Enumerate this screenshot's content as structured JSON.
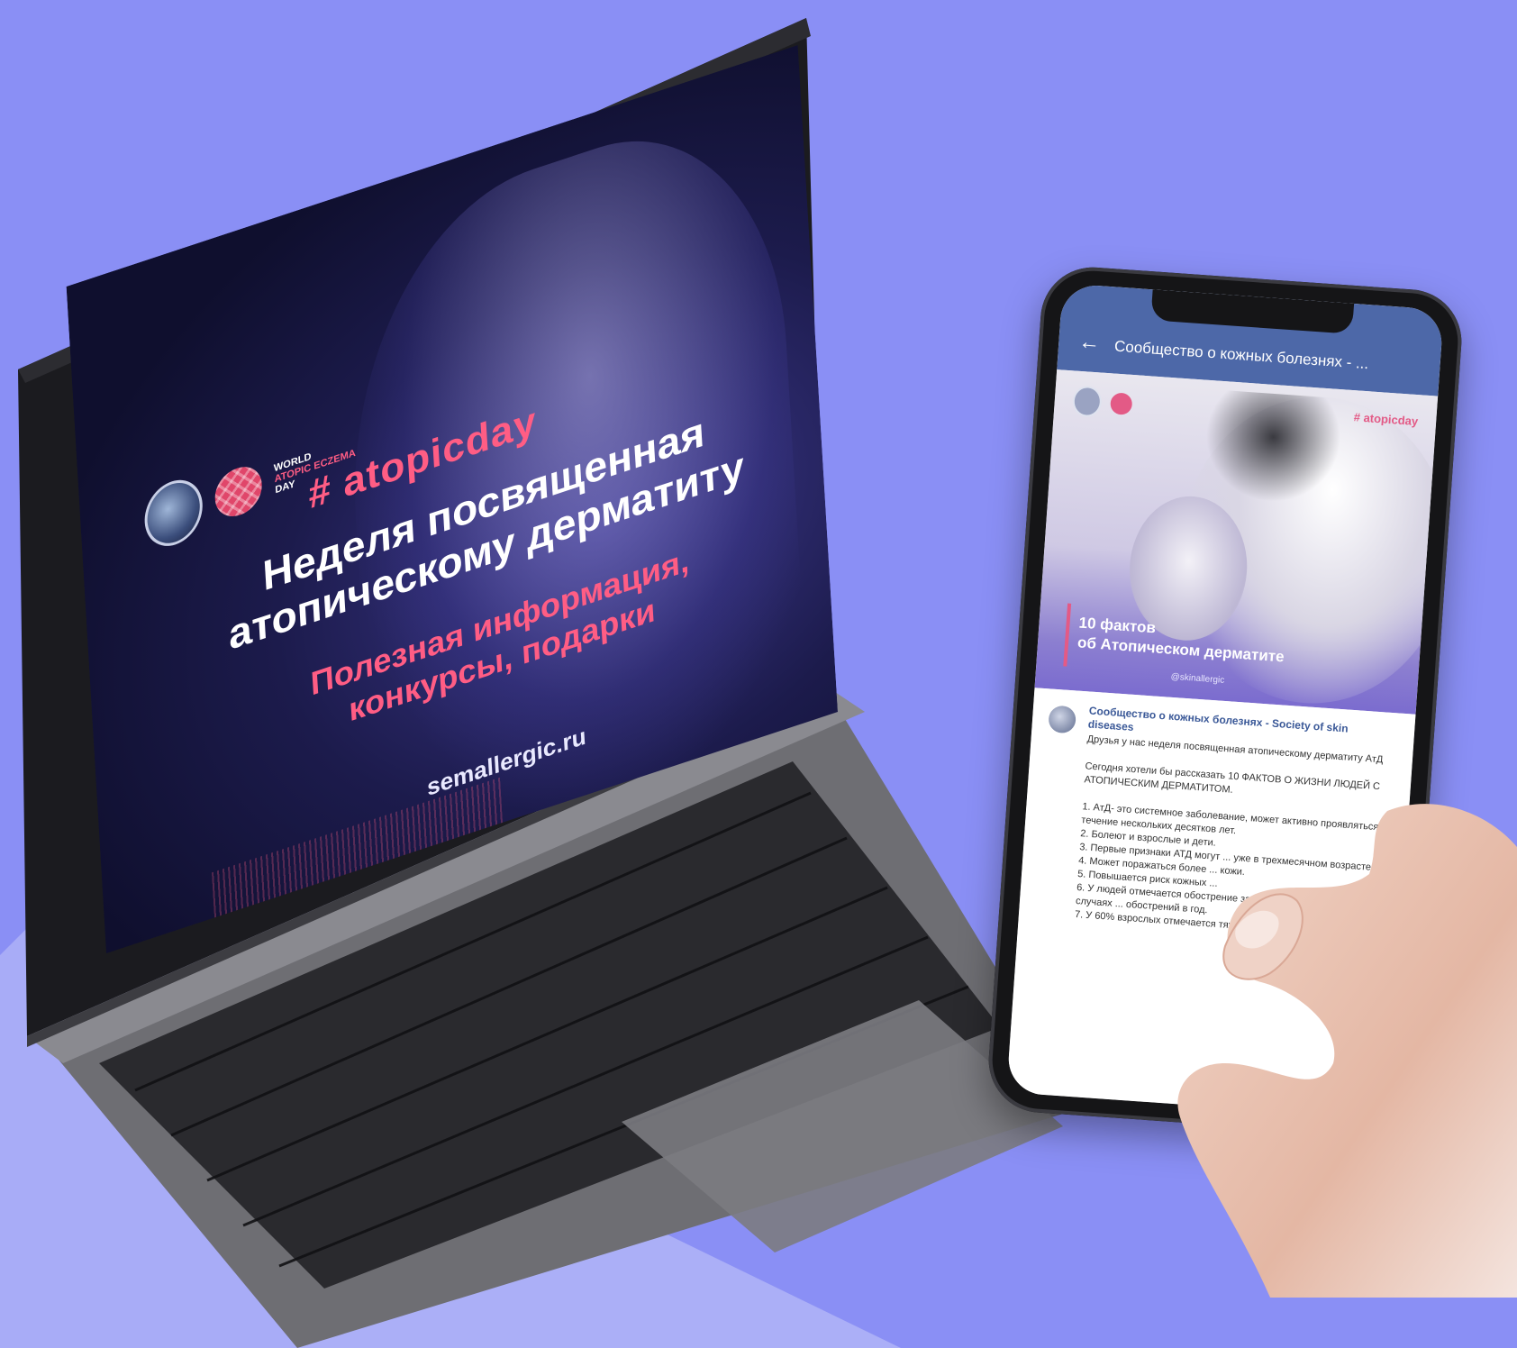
{
  "colors": {
    "background": "#8a8ff5",
    "accent_pink": "#ff5d84",
    "facebook_blue": "#4d68a8",
    "screen_dark": "#1c1b4c"
  },
  "laptop": {
    "logo_lines": [
      "WORLD",
      "ATOPIC ECZEMA",
      "DAY"
    ],
    "hashtag": "# atopicday",
    "headline": "Неделя посвященная атопическому дерматиту",
    "subline": "Полезная информация, конкурсы, подарки",
    "site": "semallergic.ru"
  },
  "phone": {
    "header_title": "Сообщество о кожных болезнях - ...",
    "image": {
      "hashtag": "# atopicday",
      "facts_title_line1": "10 фактов",
      "facts_title_line2": "об Атопическом дерматите",
      "handle": "@skinallergic"
    },
    "post": {
      "author": "Сообщество о кожных болезнях - Society of skin diseases",
      "text": "Друзья у нас неделя посвященная атопическому дерматиту АтД\n\nСегодня хотели бы рассказать 10 ФАКТОВ О ЖИЗНИ ЛЮДЕЙ С АТОПИЧЕСКИМ ДЕРМАТИТОМ.\n\n1. АтД- это системное заболевание, может активно проявляться в течение нескольких десятков лет.\n2. Болеют и взрослые и дети.\n3. Первые признаки АТД могут ... уже в трехмесячном возрасте.\n4. Может поражаться более ... кожи.\n5. Повышается риск кожных ...\n6. У людей отмечается обострение заболевания в 31%-53% случаях ... обострений в год.\n7. У 60% взрослых отмечается тяжелая ..."
    }
  }
}
